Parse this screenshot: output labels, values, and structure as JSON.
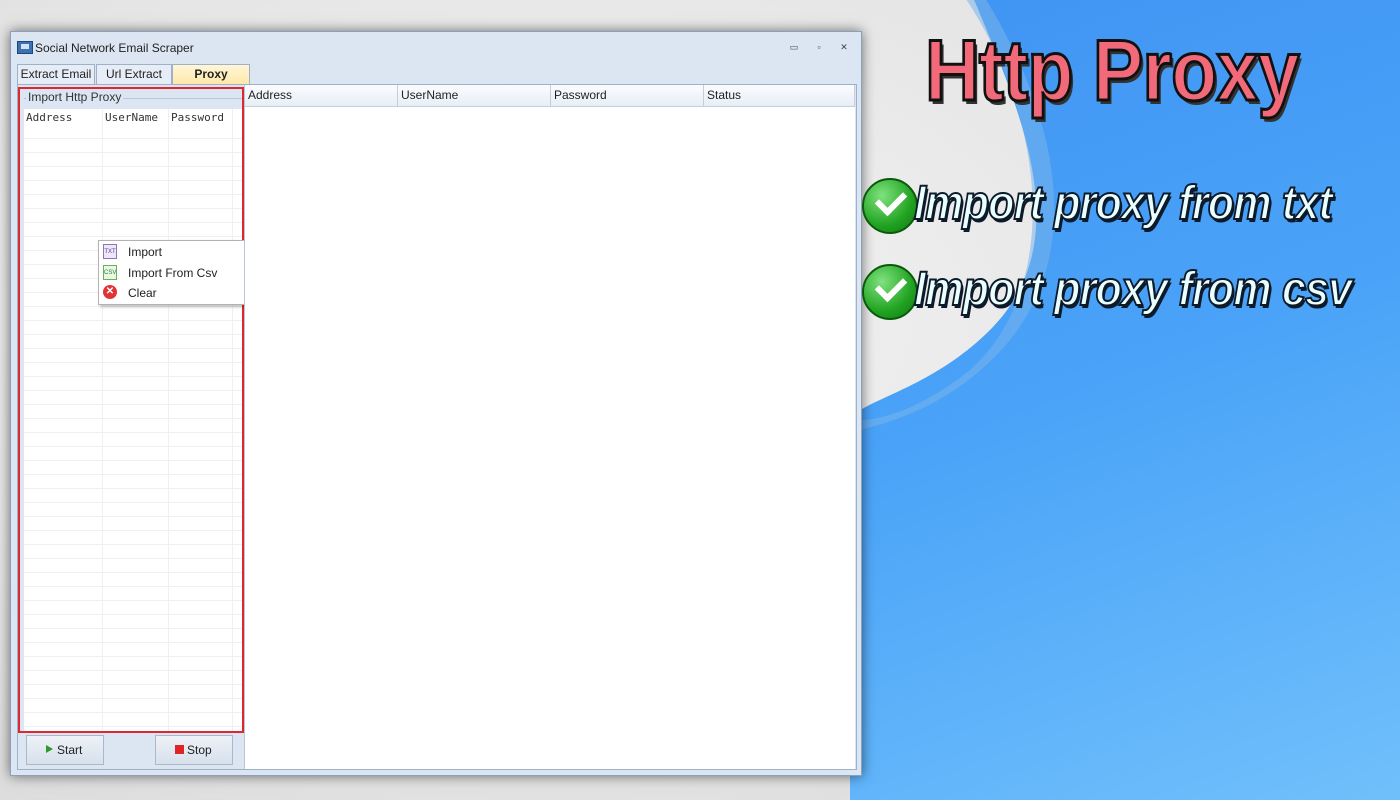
{
  "window": {
    "title": "Social Network Email Scraper",
    "controls": [
      "▭",
      "▫",
      "✕"
    ]
  },
  "tabs": [
    {
      "label": "Extract Email",
      "active": false
    },
    {
      "label": "Url Extract",
      "active": false
    },
    {
      "label": "Proxy",
      "active": true
    }
  ],
  "import_panel": {
    "group_label": "Import Http Proxy",
    "columns": [
      "Address",
      "UserName",
      "Password"
    ]
  },
  "context_menu": {
    "items": [
      {
        "label": "Import",
        "icon": "txt-file-icon",
        "icon_text": "TXT"
      },
      {
        "label": "Import From Csv",
        "icon": "csv-file-icon",
        "icon_text": "CSV"
      },
      {
        "label": "Clear",
        "icon": "clear-icon",
        "icon_text": "✕"
      }
    ]
  },
  "buttons": {
    "start": "Start",
    "stop": "Stop"
  },
  "proxy_table": {
    "columns": [
      "Address",
      "UserName",
      "Password",
      "Status"
    ]
  },
  "promo": {
    "title": "Http Proxy",
    "features": [
      "Import proxy from txt",
      "Import proxy from csv"
    ]
  },
  "colors": {
    "highlight_border": "#e0262e",
    "title_fill": "#f26a7a",
    "background_blue": "#4aa3f8",
    "check_green": "#21a321"
  }
}
